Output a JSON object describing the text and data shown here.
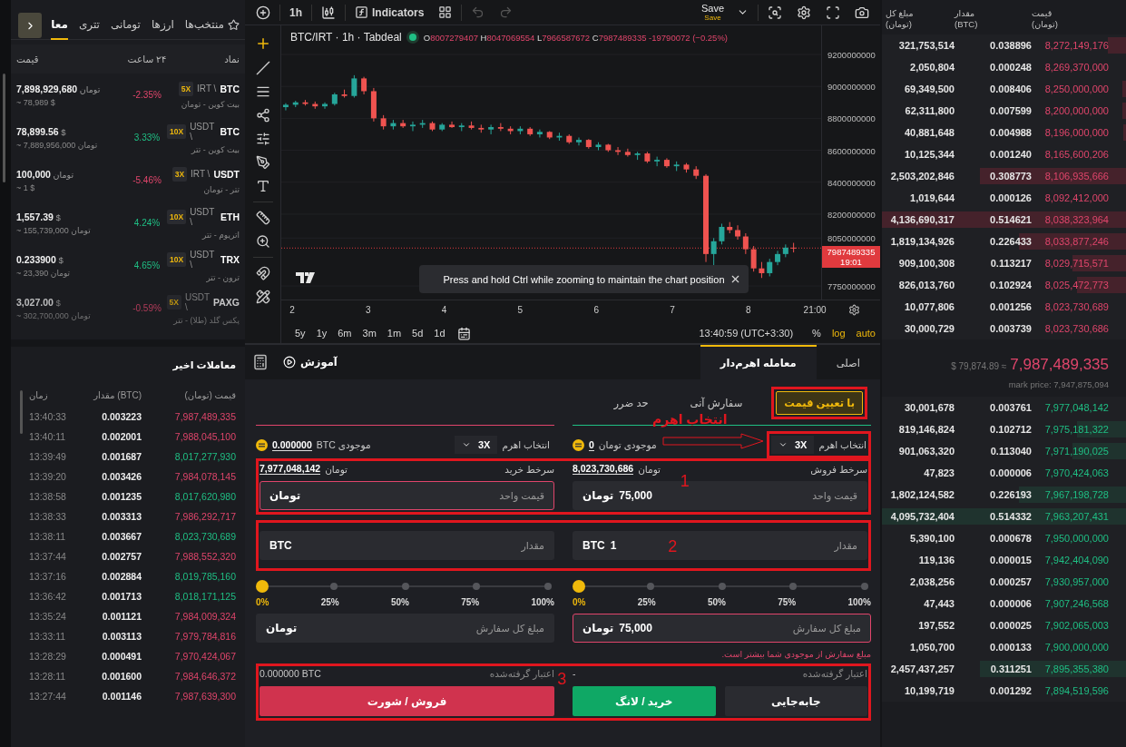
{
  "markets": {
    "tabs": [
      {
        "label": "منتخب‌ها",
        "kind": "favorites",
        "selected": false
      },
      {
        "label": "ارزها",
        "kind": "plain",
        "selected": false
      },
      {
        "label": "تومانی",
        "kind": "plain",
        "selected": false
      },
      {
        "label": "تتری",
        "kind": "plain",
        "selected": false
      },
      {
        "label": "معا",
        "kind": "plain",
        "selected": true
      }
    ],
    "columns": [
      "نماد",
      "۲۴ ساعت",
      "قیمت"
    ],
    "rows": [
      {
        "symbol": "BTC",
        "pair": "IRT \\",
        "leverage": "5X",
        "name": "بیت کوین - تومان",
        "change": "-2.35%",
        "up": false,
        "price": "**7,898,929,680** تومان",
        "approx": "~ 78,989 $",
        "faded": false
      },
      {
        "symbol": "BTC",
        "pair": "USDT \\",
        "leverage": "10X",
        "name": "بیت کوین - تتر",
        "change": "3.33%",
        "up": true,
        "price": "**78,899.56** $",
        "approx": "~ 7,889,956,000 تومان",
        "faded": false
      },
      {
        "symbol": "USDT",
        "pair": "IRT \\",
        "leverage": "3X",
        "name": "تتر - تومان",
        "change": "-5.46%",
        "up": false,
        "price": "**100,000** تومان",
        "approx": "~ 1 $",
        "faded": false
      },
      {
        "symbol": "ETH",
        "pair": "USDT \\",
        "leverage": "10X",
        "name": "اتریوم - تتر",
        "change": "4.24%",
        "up": true,
        "price": "**1,557.39** $",
        "approx": "~ 155,739,000 تومان",
        "faded": false
      },
      {
        "symbol": "TRX",
        "pair": "USDT \\",
        "leverage": "10X",
        "name": "ترون - تتر",
        "change": "4.65%",
        "up": true,
        "price": "**0.233900** $",
        "approx": "~ 23,390 تومان",
        "faded": false
      },
      {
        "symbol": "PAXG",
        "pair": "USDT \\",
        "leverage": "5X",
        "name": "پکس گلد (طلا) - تتر",
        "change": "-0.59%",
        "up": false,
        "price": "**3,027.00** $",
        "approx": "~ 302,700,000 تومان",
        "faded": true
      }
    ]
  },
  "recent_trades": {
    "title": "معاملات اخیر",
    "columns": [
      "قیمت (تومان)",
      "مقدار (BTC)",
      "زمان"
    ],
    "rows": [
      {
        "price": "7,987,489,335",
        "amount": "0.003223",
        "time": "13:40:33",
        "buy": false
      },
      {
        "price": "7,988,045,100",
        "amount": "0.002001",
        "time": "13:40:11",
        "buy": false
      },
      {
        "price": "8,017,277,930",
        "amount": "0.001687",
        "time": "13:39:49",
        "buy": true
      },
      {
        "price": "7,984,078,145",
        "amount": "0.003426",
        "time": "13:39:20",
        "buy": false
      },
      {
        "price": "8,017,620,980",
        "amount": "0.001235",
        "time": "13:38:58",
        "buy": true
      },
      {
        "price": "7,986,292,717",
        "amount": "0.003313",
        "time": "13:38:33",
        "buy": false
      },
      {
        "price": "8,023,730,689",
        "amount": "0.003667",
        "time": "13:38:11",
        "buy": true
      },
      {
        "price": "7,988,552,320",
        "amount": "0.002757",
        "time": "13:37:44",
        "buy": false
      },
      {
        "price": "8,019,785,160",
        "amount": "0.002884",
        "time": "13:37:16",
        "buy": true
      },
      {
        "price": "8,018,171,125",
        "amount": "0.001713",
        "time": "13:36:42",
        "buy": true
      },
      {
        "price": "7,984,009,324",
        "amount": "0.001121",
        "time": "13:35:24",
        "buy": false
      },
      {
        "price": "7,979,784,816",
        "amount": "0.003113",
        "time": "13:33:11",
        "buy": false
      },
      {
        "price": "7,970,424,067",
        "amount": "0.000491",
        "time": "13:28:29",
        "buy": false
      },
      {
        "price": "7,984,646,372",
        "amount": "0.001600",
        "time": "13:28:11",
        "buy": false
      },
      {
        "price": "7,987,639,300",
        "amount": "0.001146",
        "time": "13:27:44",
        "buy": false
      }
    ]
  },
  "chart": {
    "toolbar": {
      "interval": "1h",
      "indicators": "Indicators",
      "save": "Save",
      "save_sub": "Save"
    },
    "legend": {
      "title": "BTC/IRT · 1h · Tabdeal",
      "ohlc": [
        {
          "key": "O",
          "value": "8007279407"
        },
        {
          "key": "H",
          "value": "8047069554"
        },
        {
          "key": "L",
          "value": "7966587672"
        },
        {
          "key": "C",
          "value": "7987489335"
        }
      ],
      "change": "-19790072 (−0.25%)"
    },
    "chart_data": {
      "type": "candlestick",
      "xlim": [
        1.857,
        9.733
      ],
      "ylim": [
        7665000000,
        9382000000
      ],
      "grid": true,
      "ref_lines": [
        {
          "axis": "y",
          "value": 7987489335
        }
      ],
      "yticks": [
        {
          "value": 9200000000,
          "label": "9200000000"
        },
        {
          "value": 9000000000,
          "label": "9000000000"
        },
        {
          "value": 8800000000,
          "label": "8800000000"
        },
        {
          "value": 8600000000,
          "label": "8600000000"
        },
        {
          "value": 8400000000,
          "label": "8400000000"
        },
        {
          "value": 8200000000,
          "label": "8200000000"
        },
        {
          "value": 8050000000,
          "label": "8050000000"
        },
        {
          "value": 7750000000,
          "label": "7750000000"
        }
      ],
      "xticks": [
        {
          "value": 2,
          "label": "2"
        },
        {
          "value": 3,
          "label": "3"
        },
        {
          "value": 4,
          "label": "4"
        },
        {
          "value": 5,
          "label": "5"
        },
        {
          "value": 6,
          "label": "6"
        },
        {
          "value": 7,
          "label": "7"
        },
        {
          "value": 8,
          "label": "8"
        }
      ],
      "x": [
        1.916,
        2.045,
        2.173,
        2.302,
        2.43,
        2.559,
        2.687,
        2.816,
        2.944,
        3.073,
        3.201,
        3.33,
        3.458,
        3.587,
        3.715,
        3.844,
        3.972,
        4.101,
        4.229,
        4.358,
        4.486,
        4.615,
        4.743,
        4.872,
        5.0,
        5.129,
        5.257,
        5.386,
        5.514,
        5.643,
        5.771,
        5.9,
        6.028,
        6.157,
        6.285,
        6.414,
        6.542,
        6.671,
        6.799,
        6.928,
        7.056,
        7.185,
        7.313,
        7.442,
        7.545,
        7.65,
        7.755,
        7.86,
        7.965,
        8.07,
        8.175,
        8.28,
        8.385,
        8.49,
        8.595
      ],
      "ohlc": [
        [
          8870000000,
          8895000000,
          8850000000,
          8885000000
        ],
        [
          8885000000,
          8910000000,
          8870000000,
          8900000000
        ],
        [
          8900000000,
          8915000000,
          8880000000,
          8890000000
        ],
        [
          8890000000,
          8905000000,
          8860000000,
          8875000000
        ],
        [
          8875000000,
          8900000000,
          8860000000,
          8890000000
        ],
        [
          8890000000,
          8960000000,
          8880000000,
          8950000000
        ],
        [
          8950000000,
          8980000000,
          8930000000,
          8940000000
        ],
        [
          8940000000,
          9070000000,
          8930000000,
          9050000000
        ],
        [
          9050000000,
          9060000000,
          8950000000,
          8970000000
        ],
        [
          8970000000,
          8990000000,
          8780000000,
          8800000000
        ],
        [
          8800000000,
          8820000000,
          8730000000,
          8750000000
        ],
        [
          8750000000,
          8790000000,
          8730000000,
          8770000000
        ],
        [
          8770000000,
          8790000000,
          8740000000,
          8750000000
        ],
        [
          8750000000,
          8780000000,
          8720000000,
          8760000000
        ],
        [
          8760000000,
          8790000000,
          8740000000,
          8770000000
        ],
        [
          8770000000,
          8780000000,
          8720000000,
          8730000000
        ],
        [
          8730000000,
          8770000000,
          8720000000,
          8760000000
        ],
        [
          8760000000,
          8780000000,
          8740000000,
          8745000000
        ],
        [
          8745000000,
          8770000000,
          8720000000,
          8755000000
        ],
        [
          8755000000,
          8780000000,
          8730000000,
          8740000000
        ],
        [
          8740000000,
          8760000000,
          8710000000,
          8730000000
        ],
        [
          8730000000,
          8760000000,
          8700000000,
          8745000000
        ],
        [
          8745000000,
          8770000000,
          8720000000,
          8735000000
        ],
        [
          8735000000,
          8750000000,
          8700000000,
          8720000000
        ],
        [
          8720000000,
          8750000000,
          8700000000,
          8735000000
        ],
        [
          8735000000,
          8745000000,
          8690000000,
          8700000000
        ],
        [
          8700000000,
          8730000000,
          8680000000,
          8715000000
        ],
        [
          8715000000,
          8720000000,
          8670000000,
          8680000000
        ],
        [
          8680000000,
          8710000000,
          8660000000,
          8690000000
        ],
        [
          8690000000,
          8700000000,
          8640000000,
          8650000000
        ],
        [
          8650000000,
          8680000000,
          8630000000,
          8665000000
        ],
        [
          8665000000,
          8670000000,
          8610000000,
          8620000000
        ],
        [
          8620000000,
          8650000000,
          8600000000,
          8635000000
        ],
        [
          8635000000,
          8640000000,
          8590000000,
          8600000000
        ],
        [
          8600000000,
          8620000000,
          8570000000,
          8590000000
        ],
        [
          8590000000,
          8610000000,
          8560000000,
          8570000000
        ],
        [
          8570000000,
          8590000000,
          8540000000,
          8580000000
        ],
        [
          8580000000,
          8590000000,
          8520000000,
          8530000000
        ],
        [
          8530000000,
          8560000000,
          8500000000,
          8540000000
        ],
        [
          8540000000,
          8550000000,
          8490000000,
          8500000000
        ],
        [
          8500000000,
          8530000000,
          8470000000,
          8510000000
        ],
        [
          8510000000,
          8520000000,
          8460000000,
          8480000000
        ],
        [
          8480000000,
          8500000000,
          8420000000,
          8440000000
        ],
        [
          8440000000,
          8450000000,
          7900000000,
          7950000000
        ],
        [
          7950000000,
          8050000000,
          7880000000,
          8030000000
        ],
        [
          8030000000,
          8140000000,
          8010000000,
          8120000000
        ],
        [
          8120000000,
          8150000000,
          8080000000,
          8100000000
        ],
        [
          8100000000,
          8130000000,
          8040000000,
          8060000000
        ],
        [
          8060000000,
          8080000000,
          7950000000,
          7980000000
        ],
        [
          7980000000,
          8000000000,
          7840000000,
          7860000000
        ],
        [
          7860000000,
          7900000000,
          7800000000,
          7830000000
        ],
        [
          7830000000,
          7920000000,
          7810000000,
          7900000000
        ],
        [
          7900000000,
          7970000000,
          7880000000,
          7950000000
        ],
        [
          7950000000,
          8010000000,
          7930000000,
          7990000000
        ],
        [
          7990000000,
          8020000000,
          7960000000,
          7987489335
        ]
      ]
    },
    "x_end_label": "21:00",
    "last_price": "7987489335",
    "countdown": "19:01",
    "toast": "Press and hold Ctrl while zooming to maintain the chart position",
    "ranges": [
      "5y",
      "1y",
      "6m",
      "3m",
      "1m",
      "5d",
      "1d"
    ],
    "clock": "13:40:59 (UTC+3:30)",
    "scale_options": [
      {
        "label": "%",
        "selected": false
      },
      {
        "label": "log",
        "selected": true
      },
      {
        "label": "auto",
        "selected": true
      }
    ]
  },
  "order_form": {
    "tabs": [
      {
        "label": "اصلی",
        "selected": false
      },
      {
        "label": "معامله اهرم‌دار",
        "selected": true
      }
    ],
    "tutorial": "آموزش",
    "order_types": [
      {
        "label": "با تعیین قیمت",
        "selected": true,
        "highlighted": true
      },
      {
        "label": "سفارش آنی",
        "selected": false,
        "highlighted": false
      },
      {
        "label": "حد ضرر",
        "selected": false,
        "highlighted": false
      }
    ],
    "buy": {
      "leverage_label": "انتخاب اهرم",
      "leverage": "3X",
      "leverage_highlighted": true,
      "balance_label": "موجودی تومان",
      "balance": "0",
      "best_label": "سرخط فروش",
      "best_unit": "تومان",
      "best_price": "8,023,730,686",
      "price": {
        "label": "قیمت واحد",
        "value": "75,000",
        "unit": "تومان",
        "error": false
      },
      "amount": {
        "label": "مقدار",
        "value": "1",
        "unit": "BTC",
        "error": false
      },
      "slider": {
        "level": 0,
        "marks": [
          "0%",
          "25%",
          "50%",
          "75%",
          "100%"
        ]
      },
      "total": {
        "label": "مبلغ کل سفارش",
        "value": "75,000",
        "unit": "تومان",
        "error": true
      },
      "error_text": "مبلغ سفارش از موجودی شما بیشتر است.",
      "credit_label": "اعتبار گرفته‌شده",
      "credit": "-",
      "buttons": [
        {
          "label": "جابه‌جایی",
          "kind": "transfer"
        },
        {
          "label": "خرید / لانگ",
          "kind": "buy"
        }
      ]
    },
    "sell": {
      "leverage_label": "انتخاب اهرم",
      "leverage": "3X",
      "leverage_highlighted": false,
      "balance_label": "موجودی BTC",
      "balance": "0.000000",
      "best_label": "سرخط خرید",
      "best_unit": "تومان",
      "best_price": "7,977,048,142",
      "price": {
        "label": "قیمت واحد",
        "unit": "تومان",
        "error": true
      },
      "amount": {
        "label": "مقدار",
        "unit": "BTC",
        "error": false
      },
      "slider": {
        "level": 0,
        "marks": [
          "0%",
          "25%",
          "50%",
          "75%",
          "100%"
        ]
      },
      "total": {
        "label": "مبلغ کل سفارش",
        "unit": "تومان",
        "error": false
      },
      "credit_label": "اعتبار گرفته‌شده",
      "credit": "0.000000 BTC",
      "buttons": [
        {
          "label": "فروش / شورت",
          "kind": "sell"
        }
      ]
    }
  },
  "annotations": {
    "markers": [
      "1",
      "2",
      "3"
    ],
    "callout": "انتخاب اهرم"
  },
  "order_book": {
    "columns": [
      {
        "label": "قیمت",
        "unit": "(تومان)"
      },
      {
        "label": "مقدار",
        "unit": "(BTC)"
      },
      {
        "label": "مبلغ کل",
        "unit": "(تومان)"
      }
    ],
    "asks": [
      {
        "price": "8,272,149,176",
        "amount": "0.038896",
        "total": "321,753,514",
        "level": 0.076
      },
      {
        "price": "8,269,370,000",
        "amount": "0.000248",
        "total": "2,050,804"
      },
      {
        "price": "8,250,000,000",
        "amount": "0.008406",
        "total": "69,349,500",
        "level": 0.016
      },
      {
        "price": "8,200,000,000",
        "amount": "0.007599",
        "total": "62,311,800",
        "level": 0.015
      },
      {
        "price": "8,196,000,000",
        "amount": "0.004988",
        "total": "40,881,648",
        "level": 0.01
      },
      {
        "price": "8,165,600,206",
        "amount": "0.001240",
        "total": "10,125,344"
      },
      {
        "price": "8,106,935,666",
        "amount": "0.308773",
        "total": "2,503,202,846",
        "level": 0.6
      },
      {
        "price": "8,092,412,000",
        "amount": "0.000126",
        "total": "1,019,644"
      },
      {
        "price": "8,038,323,964",
        "amount": "0.514621",
        "total": "4,136,690,317",
        "level": 1.0
      },
      {
        "price": "8,033,877,246",
        "amount": "0.226433",
        "total": "1,819,134,926",
        "level": 0.44
      },
      {
        "price": "8,029,715,571",
        "amount": "0.113217",
        "total": "909,100,308",
        "level": 0.22
      },
      {
        "price": "8,025,472,773",
        "amount": "0.102924",
        "total": "826,013,760",
        "level": 0.2
      },
      {
        "price": "8,023,730,689",
        "amount": "0.001256",
        "total": "10,077,806"
      },
      {
        "price": "8,023,730,686",
        "amount": "0.003739",
        "total": "30,000,729"
      }
    ],
    "last_price": "7,987,489,335",
    "approx": "$ 79,874.89 ≈",
    "mark_price": "mark price: 7,947,875,094",
    "bids": [
      {
        "price": "7,977,048,142",
        "amount": "0.003761",
        "total": "30,001,678"
      },
      {
        "price": "7,975,181,322",
        "amount": "0.102712",
        "total": "819,146,824",
        "level": 0.2
      },
      {
        "price": "7,971,190,025",
        "amount": "0.113040",
        "total": "901,063,320",
        "level": 0.22
      },
      {
        "price": "7,970,424,063",
        "amount": "0.000006",
        "total": "47,823"
      },
      {
        "price": "7,967,198,728",
        "amount": "0.226193",
        "total": "1,802,124,582",
        "level": 0.44
      },
      {
        "price": "7,963,207,431",
        "amount": "0.514332",
        "total": "4,095,732,404",
        "level": 1.0
      },
      {
        "price": "7,950,000,000",
        "amount": "0.000678",
        "total": "5,390,100"
      },
      {
        "price": "7,942,404,090",
        "amount": "0.000015",
        "total": "119,136"
      },
      {
        "price": "7,930,957,000",
        "amount": "0.000257",
        "total": "2,038,256"
      },
      {
        "price": "7,907,246,568",
        "amount": "0.000006",
        "total": "47,443"
      },
      {
        "price": "7,902,065,003",
        "amount": "0.000025",
        "total": "197,552"
      },
      {
        "price": "7,900,000,000",
        "amount": "0.000133",
        "total": "1,050,700"
      },
      {
        "price": "7,895,355,380",
        "amount": "0.311251",
        "total": "2,457,437,257",
        "level": 0.6
      },
      {
        "price": "7,894,519,596",
        "amount": "0.001292",
        "total": "10,199,719"
      }
    ]
  }
}
